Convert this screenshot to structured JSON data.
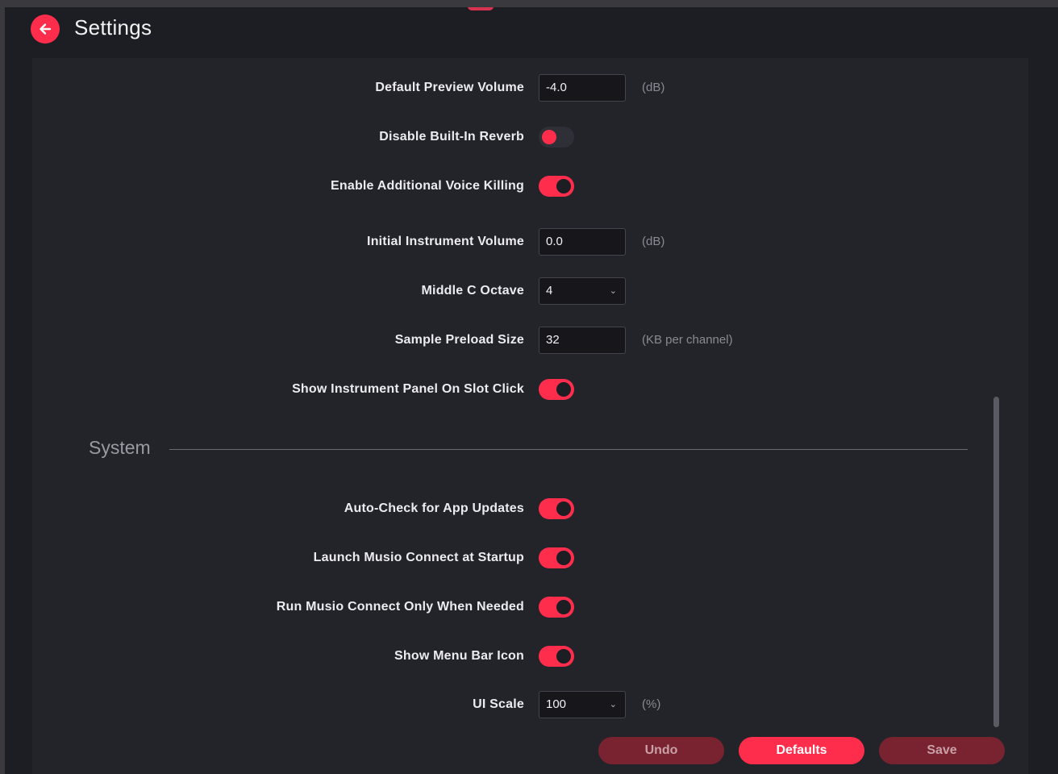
{
  "header": {
    "title": "Settings"
  },
  "settings": {
    "default_preview_volume": {
      "label": "Default Preview Volume",
      "value": "-4.0",
      "unit": "(dB)"
    },
    "disable_reverb": {
      "label": "Disable Built-In Reverb",
      "on": false
    },
    "voice_killing": {
      "label": "Enable Additional Voice Killing",
      "on": true
    },
    "instrument_volume": {
      "label": "Initial Instrument Volume",
      "value": "0.0",
      "unit": "(dB)"
    },
    "middle_c": {
      "label": "Middle C Octave",
      "value": "4"
    },
    "preload_size": {
      "label": "Sample Preload Size",
      "value": "32",
      "unit": "(KB per channel)"
    },
    "instrument_panel": {
      "label": "Show Instrument Panel On Slot Click",
      "on": true
    }
  },
  "system": {
    "title": "System",
    "auto_check": {
      "label": "Auto-Check for App Updates",
      "on": true
    },
    "launch_connect": {
      "label": "Launch Musio Connect at Startup",
      "on": true
    },
    "run_connect": {
      "label": "Run Musio Connect Only When Needed",
      "on": true
    },
    "menu_bar_icon": {
      "label": "Show Menu Bar Icon",
      "on": true
    },
    "ui_scale": {
      "label": "UI Scale",
      "value": "100",
      "unit": "(%)"
    }
  },
  "footer": {
    "undo_label": "Undo",
    "defaults_label": "Defaults",
    "save_label": "Save"
  },
  "colors": {
    "accent": "#ff2d4c",
    "background": "#1d1d24",
    "panel": "#23232a"
  }
}
